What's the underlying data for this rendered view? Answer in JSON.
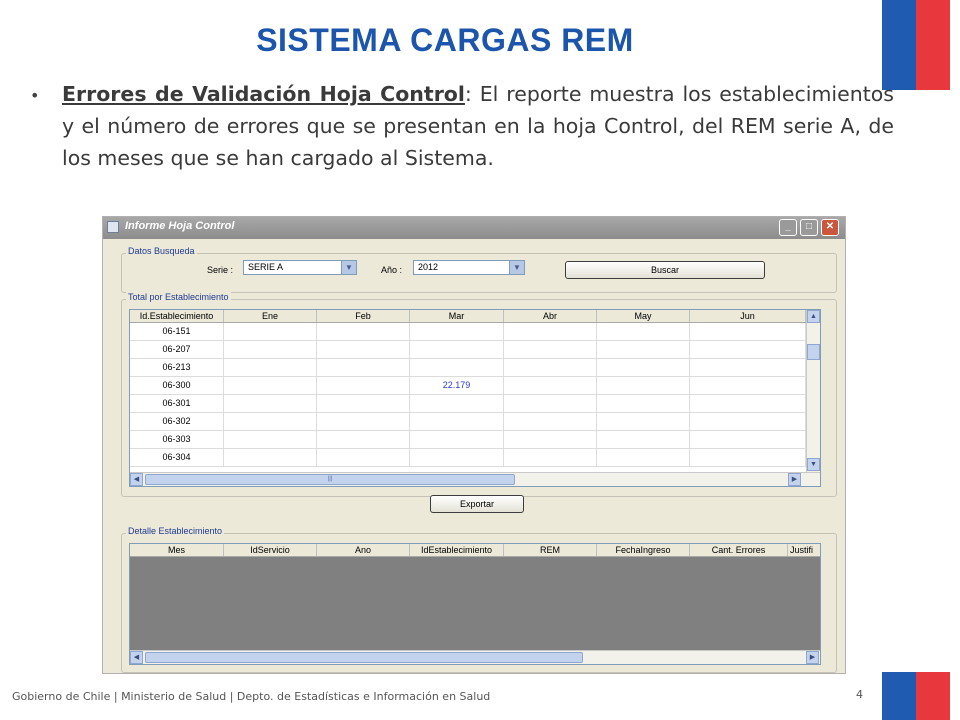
{
  "slide": {
    "title": "SISTEMA CARGAS REM",
    "lead": "Errores de Validación Hoja Control",
    "body": ": El reporte muestra los establecimientos  y  el número de  errores que se presentan en la hoja Control, del REM serie A, de los meses que se han cargado al Sistema.",
    "footer": "Gobierno de Chile | Ministerio de Salud | Depto. de Estadísticas e Información en Salud",
    "page_number": "4",
    "colors": {
      "title": "#1b55ac",
      "flag_blue": "#1f5bb0",
      "flag_red": "#e8383d"
    }
  },
  "window": {
    "title": "Informe Hoja Control",
    "controls": {
      "minimize": "_",
      "maximize": "□",
      "close": "✕"
    },
    "busqueda": {
      "legend": "Datos Busqueda",
      "serie_label": "Serie :",
      "serie_value": "SERIE A",
      "ano_label": "Año :",
      "ano_value": "2012",
      "buscar_label": "Buscar"
    },
    "total": {
      "legend": "Total por Establecimiento",
      "columns": [
        "Id.Establecimiento",
        "Ene",
        "Feb",
        "Mar",
        "Abr",
        "May",
        "Jun"
      ],
      "rows": [
        {
          "id": "06-151",
          "values": [
            "",
            "",
            "",
            "",
            "",
            ""
          ]
        },
        {
          "id": "06-207",
          "values": [
            "",
            "",
            "",
            "",
            "",
            ""
          ]
        },
        {
          "id": "06-213",
          "values": [
            "",
            "",
            "",
            "",
            "",
            ""
          ]
        },
        {
          "id": "06-300",
          "values": [
            "",
            "",
            "22.179",
            "",
            "",
            ""
          ]
        },
        {
          "id": "06-301",
          "values": [
            "",
            "",
            "",
            "",
            "",
            ""
          ]
        },
        {
          "id": "06-302",
          "values": [
            "",
            "",
            "",
            "",
            "",
            ""
          ]
        },
        {
          "id": "06-303",
          "values": [
            "",
            "",
            "",
            "",
            "",
            ""
          ]
        },
        {
          "id": "06-304",
          "values": [
            "",
            "",
            "",
            "",
            "",
            ""
          ]
        }
      ],
      "exportar_label": "Exportar"
    },
    "detalle": {
      "legend": "Detalle Establecimiento",
      "columns": [
        "Mes",
        "IdServicio",
        "Ano",
        "IdEstablecimiento",
        "REM",
        "FechaIngreso",
        "Cant. Errores",
        "Justifi"
      ]
    }
  }
}
